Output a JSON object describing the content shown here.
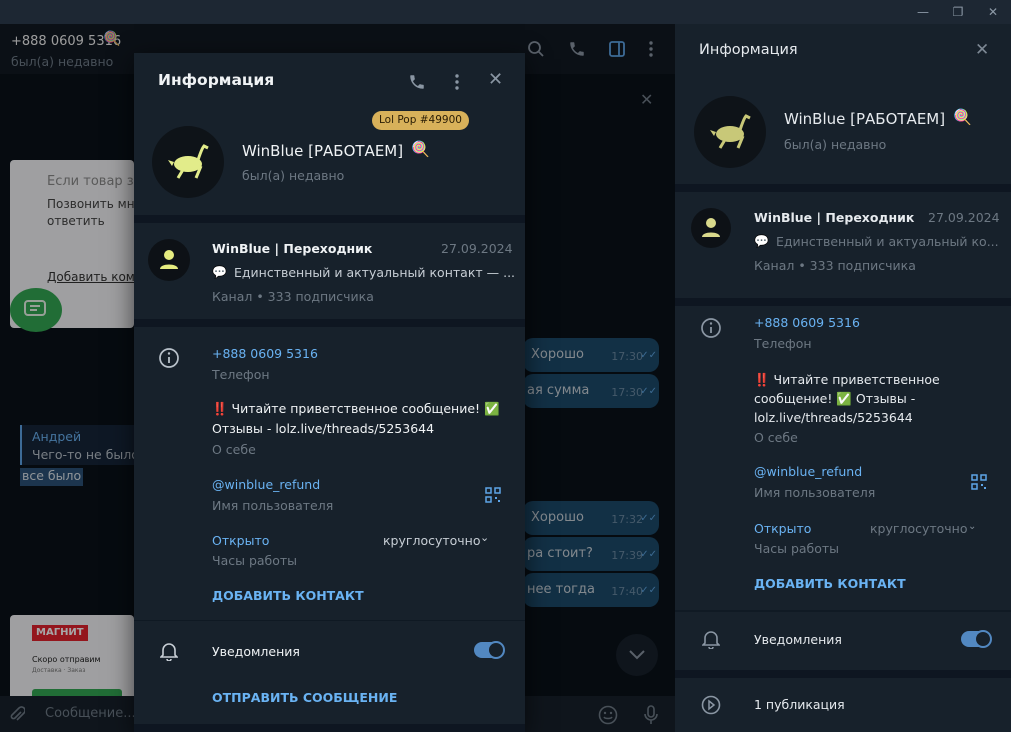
{
  "colors": {
    "bg": "#0e1621",
    "panel": "#17212b",
    "accent": "#6ab3f3",
    "toggle": "#5288c1",
    "badge": "#d8b15a"
  },
  "window": {
    "controls": [
      "—",
      "❐",
      "✕"
    ]
  },
  "chat": {
    "header": {
      "title": "+888 0609 5316",
      "status": "был(а) недавно"
    },
    "ad_card": {
      "line1": "Если товар з",
      "line2": "Позвонить мне",
      "line3": "ответить",
      "link": "Добавить комм"
    },
    "reply": {
      "author": "Андрей",
      "text": "Чего-то не было",
      "selected": "все было"
    },
    "messages": [
      {
        "text": "Хорошо",
        "time": "17:30"
      },
      {
        "text": "ая сумма",
        "time": "17:30"
      },
      {
        "text": "Хорошо",
        "time": "17:32"
      },
      {
        "text": "ра стоит?",
        "time": "17:39"
      },
      {
        "text": "нее тогда",
        "time": "17:40"
      }
    ],
    "magnit": {
      "brand": "МАГНИТ",
      "line": "Скоро отправим",
      "small": "Доставка · Заказ"
    },
    "input_placeholder": "Сообщение..."
  },
  "info_panel": {
    "title": "Информация",
    "name": "WinBlue [РАБОТАЕМ]",
    "status": "был(а) недавно",
    "channel": {
      "name": "WinBlue | Переходник",
      "date": "27.09.2024",
      "desc": "Единственный и актуальный ко...",
      "subs": "Канал • 333 подписчика"
    },
    "phone": "+888 0609 5316",
    "phone_label": "Телефон",
    "bio": "‼️ Читайте приветственное сообщение! ✅ Отзывы - lolz.live/threads/5253644",
    "bio_label": "О себе",
    "username": "@winblue_refund",
    "username_label": "Имя пользователя",
    "hours_status": "Открыто",
    "hours_value": "круглосуточно",
    "hours_label": "Часы работы",
    "add_contact": "ДОБАВИТЬ КОНТАКТ",
    "notifications": "Уведомления",
    "publications": "1 публикация"
  },
  "modal": {
    "title": "Информация",
    "badge": "Lol Pop #49900",
    "name": "WinBlue [РАБОТАЕМ]",
    "status": "был(а) недавно",
    "channel": {
      "name": "WinBlue | Переходник",
      "date": "27.09.2024",
      "desc": "Единственный и актуальный контакт — ...",
      "subs": "Канал • 333 подписчика"
    },
    "phone": "+888 0609 5316",
    "phone_label": "Телефон",
    "bio_line1": "‼️ Читайте приветственное сообщение! ✅",
    "bio_line2": "Отзывы - lolz.live/threads/5253644",
    "bio_label": "О себе",
    "username": "@winblue_refund",
    "username_label": "Имя пользователя",
    "hours_status": "Открыто",
    "hours_value": "круглосуточно",
    "hours_label": "Часы работы",
    "add_contact": "ДОБАВИТЬ КОНТАКТ",
    "notifications": "Уведомления",
    "send_message": "ОТПРАВИТЬ СООБЩЕНИЕ"
  }
}
